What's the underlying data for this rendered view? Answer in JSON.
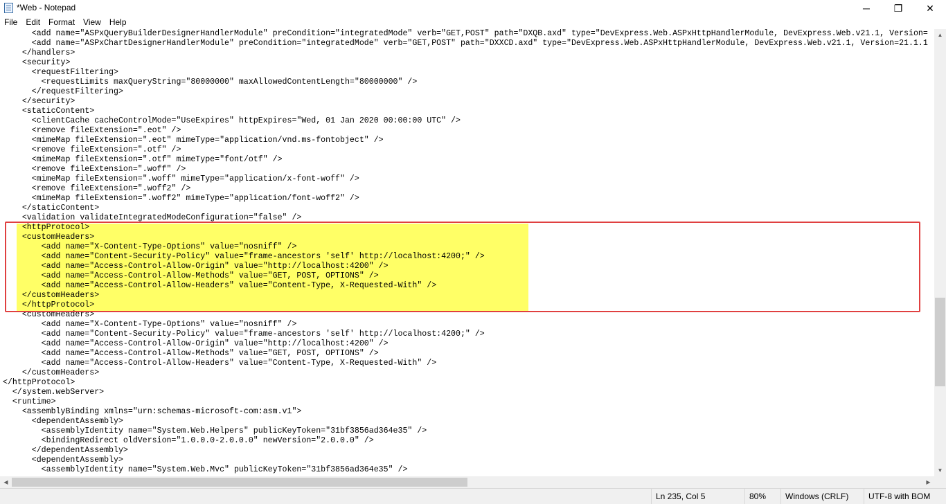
{
  "window": {
    "title": "*Web - Notepad",
    "minimize_glyph": "─",
    "maximize_glyph": "❐",
    "close_glyph": "✕"
  },
  "icons": {
    "app": "notepad-icon",
    "minimize": "minimize-icon",
    "maximize": "restore-icon",
    "close": "close-icon"
  },
  "menu": [
    {
      "label": "File"
    },
    {
      "label": "Edit"
    },
    {
      "label": "Format"
    },
    {
      "label": "View"
    },
    {
      "label": "Help"
    }
  ],
  "editor": {
    "lines": [
      "      <add name=\"ASPxQueryBuilderDesignerHandlerModule\" preCondition=\"integratedMode\" verb=\"GET,POST\" path=\"DXQB.axd\" type=\"DevExpress.Web.ASPxHttpHandlerModule, DevExpress.Web.v21.1, Version=",
      "      <add name=\"ASPxChartDesignerHandlerModule\" preCondition=\"integratedMode\" verb=\"GET,POST\" path=\"DXXCD.axd\" type=\"DevExpress.Web.ASPxHttpHandlerModule, DevExpress.Web.v21.1, Version=21.1.1",
      "    </handlers>",
      "    <security>",
      "      <requestFiltering>",
      "        <requestLimits maxQueryString=\"80000000\" maxAllowedContentLength=\"80000000\" />",
      "      </requestFiltering>",
      "    </security>",
      "    <staticContent>",
      "      <clientCache cacheControlMode=\"UseExpires\" httpExpires=\"Wed, 01 Jan 2020 00:00:00 UTC\" />",
      "      <remove fileExtension=\".eot\" />",
      "      <mimeMap fileExtension=\".eot\" mimeType=\"application/vnd.ms-fontobject\" />",
      "      <remove fileExtension=\".otf\" />",
      "      <mimeMap fileExtension=\".otf\" mimeType=\"font/otf\" />",
      "      <remove fileExtension=\".woff\" />",
      "      <mimeMap fileExtension=\".woff\" mimeType=\"application/x-font-woff\" />",
      "      <remove fileExtension=\".woff2\" />",
      "      <mimeMap fileExtension=\".woff2\" mimeType=\"application/font-woff2\" />",
      "    </staticContent>",
      "    <validation validateIntegratedModeConfiguration=\"false\" />",
      "    <httpProtocol>",
      "    <customHeaders>",
      "        <add name=\"X-Content-Type-Options\" value=\"nosniff\" />",
      "        <add name=\"Content-Security-Policy\" value=\"frame-ancestors 'self' http://localhost:4200;\" />",
      "        <add name=\"Access-Control-Allow-Origin\" value=\"http://localhost:4200\" />",
      "        <add name=\"Access-Control-Allow-Methods\" value=\"GET, POST, OPTIONS\" />",
      "        <add name=\"Access-Control-Allow-Headers\" value=\"Content-Type, X-Requested-With\" />",
      "    </customHeaders>",
      "    </httpProtocol>",
      "    <customHeaders>",
      "        <add name=\"X-Content-Type-Options\" value=\"nosniff\" />",
      "        <add name=\"Content-Security-Policy\" value=\"frame-ancestors 'self' http://localhost:4200;\" />",
      "        <add name=\"Access-Control-Allow-Origin\" value=\"http://localhost:4200\" />",
      "        <add name=\"Access-Control-Allow-Methods\" value=\"GET, POST, OPTIONS\" />",
      "        <add name=\"Access-Control-Allow-Headers\" value=\"Content-Type, X-Requested-With\" />",
      "    </customHeaders>",
      "</httpProtocol>",
      "  </system.webServer>",
      "  <runtime>",
      "    <assemblyBinding xmlns=\"urn:schemas-microsoft-com:asm.v1\">",
      "      <dependentAssembly>",
      "        <assemblyIdentity name=\"System.Web.Helpers\" publicKeyToken=\"31bf3856ad364e35\" />",
      "        <bindingRedirect oldVersion=\"1.0.0.0-2.0.0.0\" newVersion=\"2.0.0.0\" />",
      "      </dependentAssembly>",
      "      <dependentAssembly>",
      "        <assemblyIdentity name=\"System.Web.Mvc\" publicKeyToken=\"31bf3856ad364e35\" />"
    ],
    "highlight_color": "#ffff66",
    "annotation_color": "#e04040"
  },
  "scrollbars": {
    "up_glyph": "▲",
    "down_glyph": "▼",
    "left_glyph": "◀",
    "right_glyph": "▶"
  },
  "status": {
    "position": "Ln 235, Col 5",
    "zoom": "80%",
    "line_ending": "Windows (CRLF)",
    "encoding": "UTF-8 with BOM"
  }
}
